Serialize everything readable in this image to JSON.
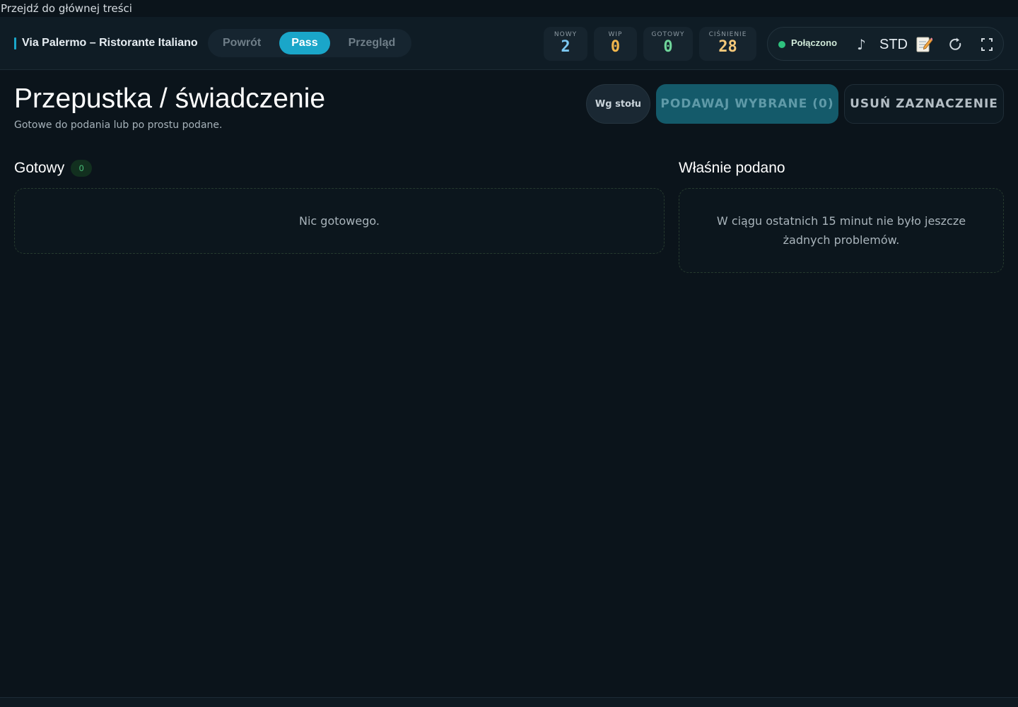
{
  "skip_link": "Przejdź do głównej treści",
  "header": {
    "brand": "Via Palermo – Ristorante Italiano",
    "modes": [
      {
        "label": "Powrót",
        "active": false
      },
      {
        "label": "Pass",
        "active": true
      },
      {
        "label": "Przegląd",
        "active": false
      }
    ],
    "stats": [
      {
        "label": "NOWY",
        "value": "2",
        "color": "#7cc8f2"
      },
      {
        "label": "WIP",
        "value": "0",
        "color": "#f0b64c"
      },
      {
        "label": "GOTOWY",
        "value": "0",
        "color": "#6fd49a"
      },
      {
        "label": "CIŚNIENIE",
        "value": "28",
        "color": "#f5c97a"
      }
    ],
    "connection": {
      "label": "Połączono",
      "color": "#2ec27e"
    },
    "sound_icon": "music-note-icon",
    "mode_label": "STD",
    "memo_icon": "memo-icon",
    "refresh_icon": "refresh-icon",
    "fullscreen_icon": "fullscreen-icon"
  },
  "main": {
    "title": "Przepustka / świadczenie",
    "subtitle": "Gotowe do podania lub po prostu podane.",
    "buttons": {
      "by_table": "Wg stołu",
      "serve_selected": "PODAWAJ WYBRANE (0)",
      "clear_selection": "USUŃ ZAZNACZENIE"
    },
    "ready": {
      "title": "Gotowy",
      "count": "0",
      "empty": "Nic gotowego."
    },
    "served": {
      "title": "Właśnie podano",
      "empty": "W ciągu ostatnich 15 minut nie było jeszcze żadnych problemów."
    }
  },
  "colors": {
    "accent": "#1aa6c9",
    "background": "#0b141b",
    "ready_green": "#4cc47d"
  }
}
